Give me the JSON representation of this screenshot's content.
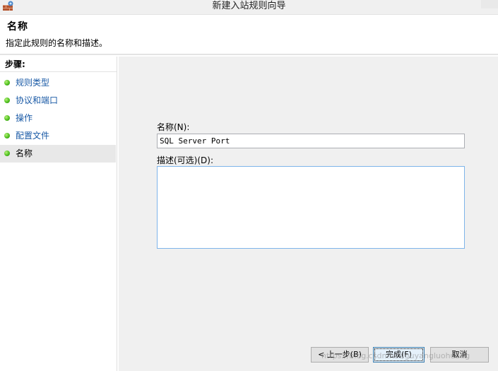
{
  "window": {
    "title": "新建入站规则向导"
  },
  "header": {
    "title": "名称",
    "subtitle": "指定此规则的名称和描述。"
  },
  "steps": {
    "title": "步骤:",
    "items": [
      {
        "label": "规则类型",
        "current": false
      },
      {
        "label": "协议和端口",
        "current": false
      },
      {
        "label": "操作",
        "current": false
      },
      {
        "label": "配置文件",
        "current": false
      },
      {
        "label": "名称",
        "current": true
      }
    ]
  },
  "form": {
    "name_label": "名称(N):",
    "name_value": "SQL Server Port",
    "description_label": "描述(可选)(D):",
    "description_value": ""
  },
  "buttons": {
    "back": "< 上一步(B)",
    "finish": "完成(F)",
    "cancel": "取消"
  },
  "watermark": "https://blog.csdn.net/guyangluohuang"
}
